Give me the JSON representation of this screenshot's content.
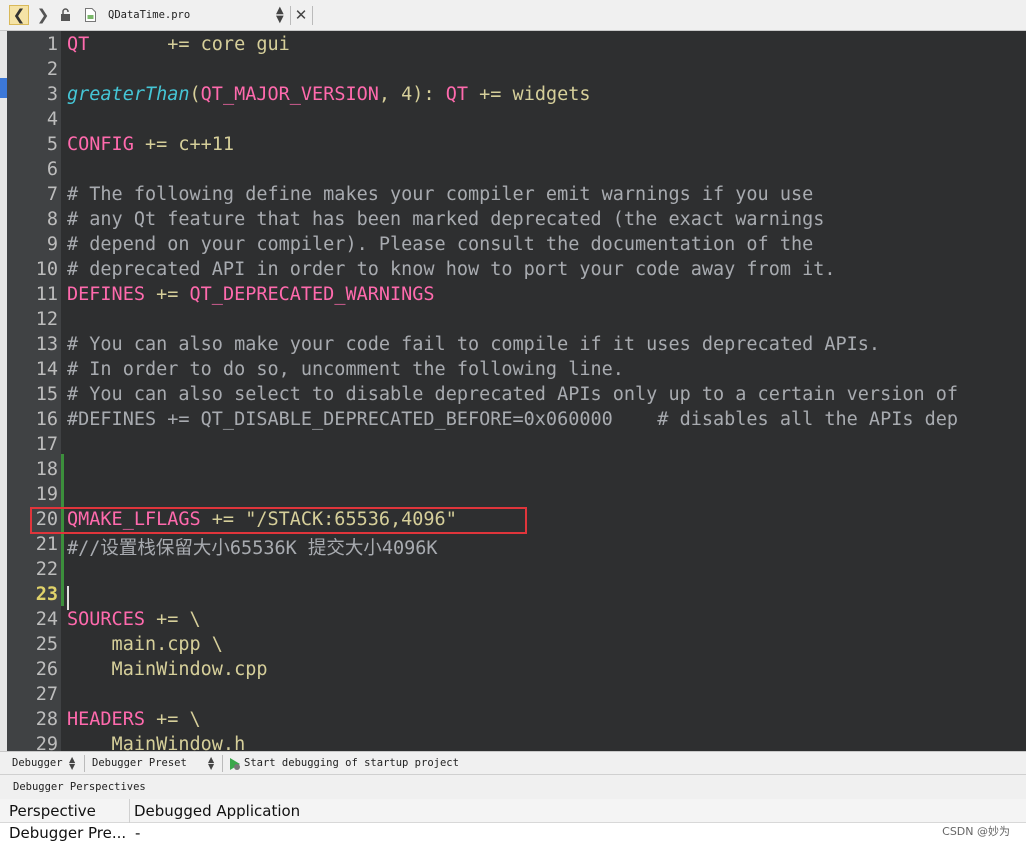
{
  "toolbar": {
    "file_name": "QDataTime.pro",
    "back_glyph": "❮",
    "forward_glyph": "❯",
    "close_glyph": "✕",
    "icons": [
      "chevron-left-icon",
      "chevron-right-icon",
      "lock-icon",
      "file-icon",
      "chevron-updown-icon",
      "close-icon"
    ]
  },
  "editor": {
    "current_line": 23,
    "lines": [
      {
        "n": "1",
        "t": "QT       += core gui"
      },
      {
        "n": "2",
        "t": ""
      },
      {
        "n": "3",
        "t": "greaterThan(QT_MAJOR_VERSION, 4): QT += widgets"
      },
      {
        "n": "4",
        "t": ""
      },
      {
        "n": "5",
        "t": "CONFIG += c++11"
      },
      {
        "n": "6",
        "t": ""
      },
      {
        "n": "7",
        "t": "# The following define makes your compiler emit warnings if you use"
      },
      {
        "n": "8",
        "t": "# any Qt feature that has been marked deprecated (the exact warnings"
      },
      {
        "n": "9",
        "t": "# depend on your compiler). Please consult the documentation of the"
      },
      {
        "n": "10",
        "t": "# deprecated API in order to know how to port your code away from it."
      },
      {
        "n": "11",
        "t": "DEFINES += QT_DEPRECATED_WARNINGS"
      },
      {
        "n": "12",
        "t": ""
      },
      {
        "n": "13",
        "t": "# You can also make your code fail to compile if it uses deprecated APIs."
      },
      {
        "n": "14",
        "t": "# In order to do so, uncomment the following line."
      },
      {
        "n": "15",
        "t": "# You can also select to disable deprecated APIs only up to a certain version of"
      },
      {
        "n": "16",
        "t": "#DEFINES += QT_DISABLE_DEPRECATED_BEFORE=0x060000    # disables all the APIs dep"
      },
      {
        "n": "17",
        "t": ""
      },
      {
        "n": "18",
        "t": ""
      },
      {
        "n": "19",
        "t": ""
      },
      {
        "n": "20",
        "t": "QMAKE_LFLAGS += \"/STACK:65536,4096\""
      },
      {
        "n": "21",
        "t": "#//设置栈保留大小65536K 提交大小4096K"
      },
      {
        "n": "22",
        "t": ""
      },
      {
        "n": "23",
        "t": ""
      },
      {
        "n": "24",
        "t": "SOURCES += \\"
      },
      {
        "n": "25",
        "t": "    main.cpp \\"
      },
      {
        "n": "26",
        "t": "    MainWindow.cpp"
      },
      {
        "n": "27",
        "t": ""
      },
      {
        "n": "28",
        "t": "HEADERS += \\"
      },
      {
        "n": "29",
        "t": "    MainWindow.h"
      }
    ]
  },
  "debug_toolbar": {
    "debugger_label": "Debugger",
    "preset_label": "Debugger Preset",
    "start_label": "Start debugging of startup project"
  },
  "perspectives": {
    "header": "Debugger Perspectives",
    "row1": {
      "col1": "Perspective",
      "col2": "Debugged Application"
    },
    "row2": {
      "col1": "Debugger Pre...",
      "col2": "-"
    }
  },
  "watermark": "CSDN @妙为",
  "colors": {
    "editor_bg": "#2e2f30",
    "gutter_bg": "#404244",
    "variable": "#ff6aad",
    "function": "#45c6d6",
    "comment": "#a8abb0",
    "plain": "#d6cf9a",
    "highlight_box": "#e0353b"
  }
}
